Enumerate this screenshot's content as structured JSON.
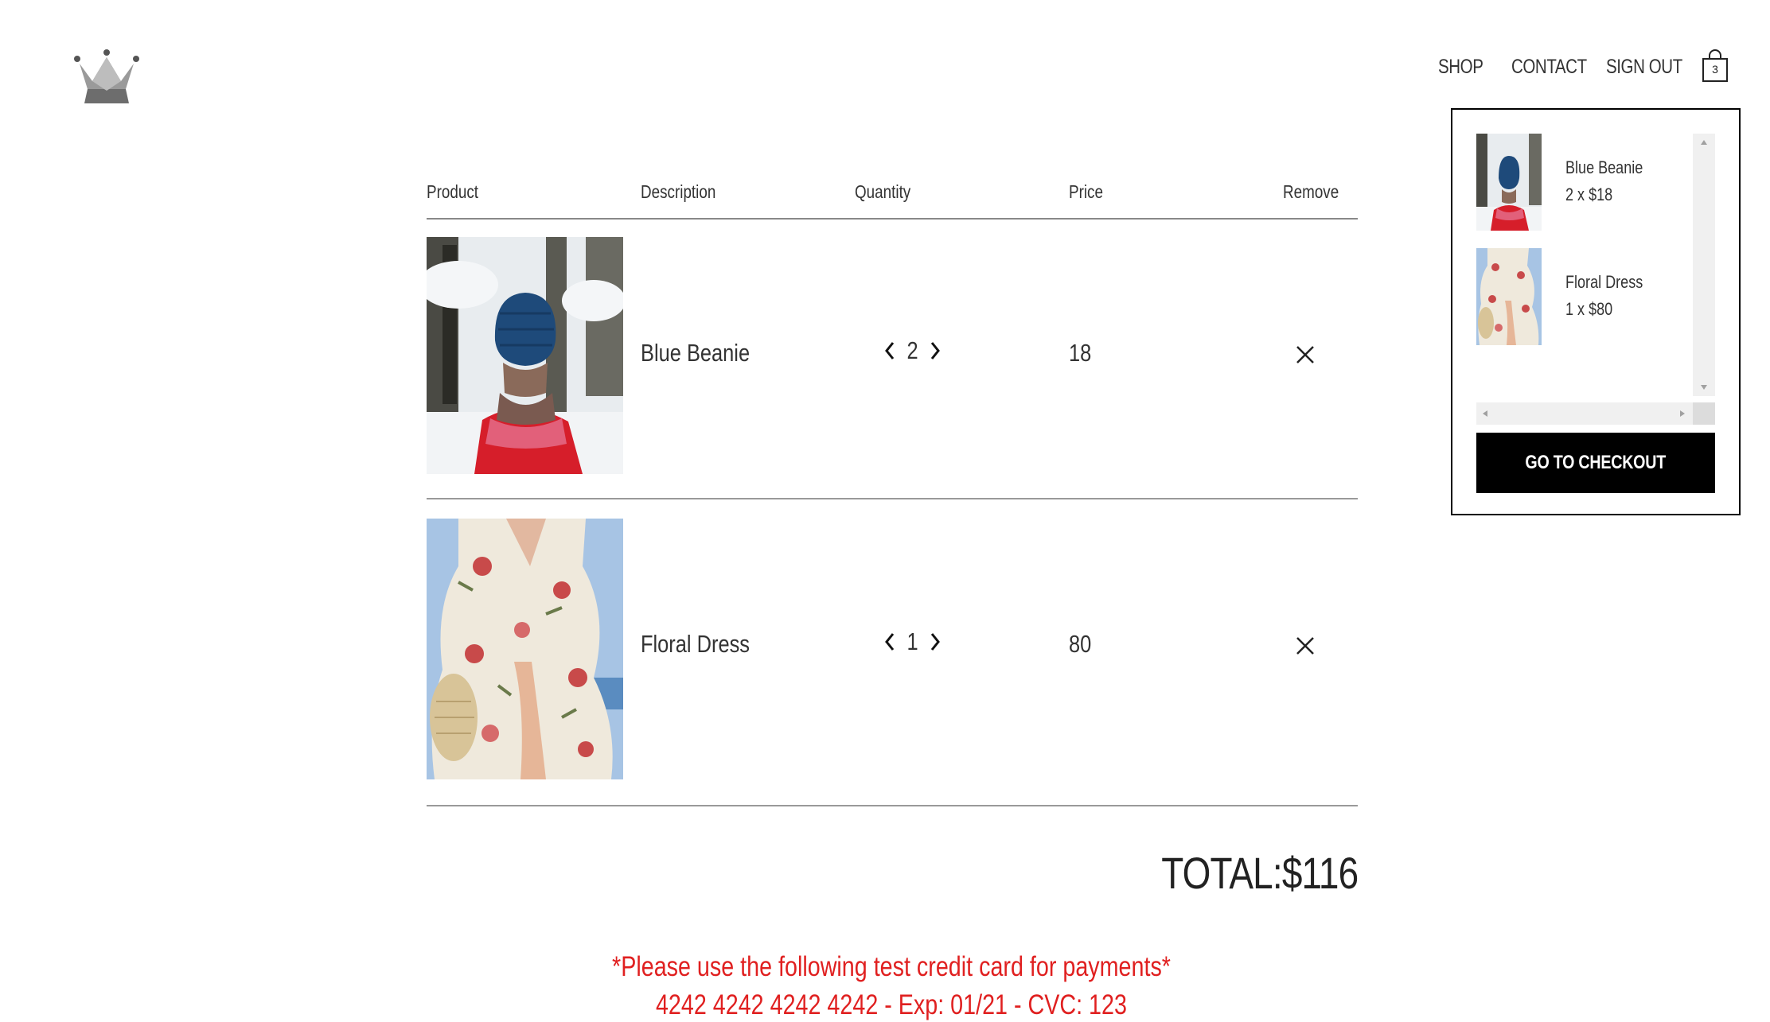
{
  "header": {
    "logo_icon": "crown-icon",
    "nav": [
      {
        "label": "SHOP"
      },
      {
        "label": "CONTACT"
      },
      {
        "label": "SIGN OUT"
      }
    ],
    "cart_icon": "shopping-bag-icon",
    "cart_count": "3"
  },
  "table": {
    "headers": [
      "Product",
      "Description",
      "Quantity",
      "Price",
      "Remove"
    ],
    "rows": [
      {
        "image": "blue-beanie-photo",
        "description": "Blue Beanie",
        "quantity": "2",
        "price": "18"
      },
      {
        "image": "floral-dress-photo",
        "description": "Floral Dress",
        "quantity": "1",
        "price": "80"
      }
    ]
  },
  "total": "TOTAL:$116",
  "notice": {
    "line1": "*Please use the following test credit card for payments*",
    "line2": "4242 4242 4242 4242 - Exp: 01/21 - CVC: 123",
    "color": "#e02020"
  },
  "cart_dropdown": {
    "items": [
      {
        "name": "Blue Beanie",
        "qty_price": "2 x $18"
      },
      {
        "name": "Floral Dress",
        "qty_price": "1 x $80"
      }
    ],
    "checkout_label": "GO TO CHECKOUT"
  }
}
